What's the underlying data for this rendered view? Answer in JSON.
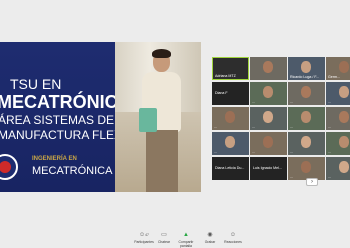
{
  "slide": {
    "line1": "TSU EN",
    "line2": "MECATRÓNICA",
    "line3": "ÁREA SISTEMAS DE",
    "line4": "MANUFACTURA FLEXIBLE",
    "engineering": "INGENIERÍA EN",
    "mecatronica": "MECATRÓNICA"
  },
  "participants": [
    {
      "name": "Adriana MTZ",
      "highlight": true
    },
    {
      "name": "",
      "video": true
    },
    {
      "name": "Ricardo Luga / F...",
      "video": true
    },
    {
      "name": "Germ...",
      "video": true
    },
    {
      "name": "Diana F",
      "dark": true
    },
    {
      "name": "...",
      "video": true
    },
    {
      "name": "...",
      "video": true
    },
    {
      "name": "...",
      "video": true
    },
    {
      "name": "...",
      "video": true
    },
    {
      "name": "...",
      "video": true
    },
    {
      "name": "...",
      "video": true
    },
    {
      "name": "...",
      "video": true
    },
    {
      "name": "...",
      "video": true
    },
    {
      "name": "...",
      "video": true
    },
    {
      "name": "...",
      "video": true
    },
    {
      "name": "...",
      "video": true
    },
    {
      "name": "Diana Leticia Du...",
      "dark": true
    },
    {
      "name": "Luis Ignacio Mel...",
      "dark": true
    },
    {
      "name": "...",
      "video": true
    },
    {
      "name": "...",
      "video": true
    }
  ],
  "grid_pager": "›",
  "toolbar": {
    "participants": {
      "icon": "people-icon",
      "label": "Participantes",
      "count": "47"
    },
    "chat": {
      "icon": "chat-icon",
      "label": "Chatear"
    },
    "share": {
      "icon": "share-screen-icon",
      "label": "Compartir pantalla"
    },
    "record": {
      "icon": "record-icon",
      "label": "Grabar"
    },
    "reactions": {
      "icon": "reactions-icon",
      "label": "Reacciones"
    }
  }
}
